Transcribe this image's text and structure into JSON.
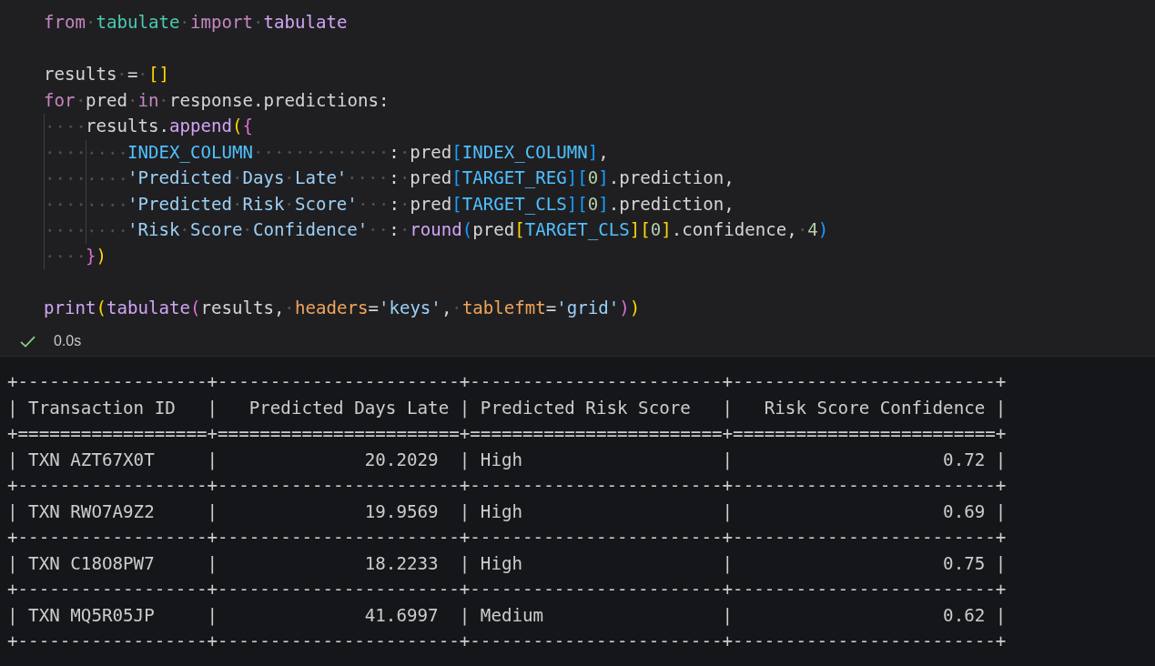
{
  "code": {
    "lines": [
      {
        "kind": "code",
        "tokens": [
          {
            "kind": "keyword",
            "text": "from "
          },
          {
            "kind": "module",
            "text": "tabulate "
          },
          {
            "kind": "keyword",
            "text": "import "
          },
          {
            "kind": "function",
            "text": "tabulate"
          }
        ]
      },
      {
        "kind": "blank"
      },
      {
        "kind": "code",
        "tokens": [
          {
            "kind": "plain",
            "text": "results = "
          },
          {
            "kind": "bracket1",
            "text": "[]"
          }
        ]
      },
      {
        "kind": "code",
        "tokens": [
          {
            "kind": "keyword",
            "text": "for"
          },
          {
            "kind": "plain",
            "text": " pred "
          },
          {
            "kind": "keyword",
            "text": "in"
          },
          {
            "kind": "plain",
            "text": " response.predictions:"
          }
        ],
        "children": [
          {
            "kind": "code",
            "tokens": [
              {
                "kind": "plain",
                "text": "results."
              },
              {
                "kind": "function",
                "text": "append"
              },
              {
                "kind": "bracket1",
                "text": "("
              },
              {
                "kind": "bracket2",
                "text": "{"
              }
            ],
            "children": [
              {
                "kind": "code",
                "tokens": [
                  {
                    "kind": "constant",
                    "text": "INDEX_COLUMN"
                  },
                  {
                    "kind": "plain",
                    "text": "             : pred"
                  },
                  {
                    "kind": "bracket3",
                    "text": "["
                  },
                  {
                    "kind": "constant",
                    "text": "INDEX_COLUMN"
                  },
                  {
                    "kind": "bracket3",
                    "text": "]"
                  },
                  {
                    "kind": "plain",
                    "text": ","
                  }
                ]
              },
              {
                "kind": "code",
                "tokens": [
                  {
                    "kind": "string",
                    "text": "'Predicted Days Late'"
                  },
                  {
                    "kind": "plain",
                    "text": "    : pred"
                  },
                  {
                    "kind": "bracket3",
                    "text": "["
                  },
                  {
                    "kind": "constant",
                    "text": "TARGET_REG"
                  },
                  {
                    "kind": "bracket3",
                    "text": "]["
                  },
                  {
                    "kind": "number",
                    "text": "0"
                  },
                  {
                    "kind": "bracket3",
                    "text": "]"
                  },
                  {
                    "kind": "plain",
                    "text": ".prediction,"
                  }
                ]
              },
              {
                "kind": "code",
                "tokens": [
                  {
                    "kind": "string",
                    "text": "'Predicted Risk Score'"
                  },
                  {
                    "kind": "plain",
                    "text": "   : pred"
                  },
                  {
                    "kind": "bracket3",
                    "text": "["
                  },
                  {
                    "kind": "constant",
                    "text": "TARGET_CLS"
                  },
                  {
                    "kind": "bracket3",
                    "text": "]["
                  },
                  {
                    "kind": "number",
                    "text": "0"
                  },
                  {
                    "kind": "bracket3",
                    "text": "]"
                  },
                  {
                    "kind": "plain",
                    "text": ".prediction,"
                  }
                ]
              },
              {
                "kind": "code",
                "tokens": [
                  {
                    "kind": "string",
                    "text": "'Risk Score Confidence'"
                  },
                  {
                    "kind": "plain",
                    "text": "  : "
                  },
                  {
                    "kind": "function",
                    "text": "round"
                  },
                  {
                    "kind": "bracket3",
                    "text": "("
                  },
                  {
                    "kind": "plain",
                    "text": "pred"
                  },
                  {
                    "kind": "bracket1",
                    "text": "["
                  },
                  {
                    "kind": "constant",
                    "text": "TARGET_CLS"
                  },
                  {
                    "kind": "bracket1",
                    "text": "]["
                  },
                  {
                    "kind": "number",
                    "text": "0"
                  },
                  {
                    "kind": "bracket1",
                    "text": "]"
                  },
                  {
                    "kind": "plain",
                    "text": ".confidence, "
                  },
                  {
                    "kind": "number",
                    "text": "4"
                  },
                  {
                    "kind": "bracket3",
                    "text": ")"
                  }
                ]
              }
            ]
          },
          {
            "kind": "code",
            "tokens": [
              {
                "kind": "bracket2",
                "text": "}"
              },
              {
                "kind": "bracket1",
                "text": ")"
              }
            ]
          }
        ]
      },
      {
        "kind": "blank"
      },
      {
        "kind": "code",
        "tokens": [
          {
            "kind": "function",
            "text": "print"
          },
          {
            "kind": "bracket1",
            "text": "("
          },
          {
            "kind": "function",
            "text": "tabulate"
          },
          {
            "kind": "bracket2",
            "text": "("
          },
          {
            "kind": "plain",
            "text": "results, "
          },
          {
            "kind": "parameter",
            "text": "headers"
          },
          {
            "kind": "plain",
            "text": "="
          },
          {
            "kind": "string",
            "text": "'keys'"
          },
          {
            "kind": "plain",
            "text": ", "
          },
          {
            "kind": "parameter",
            "text": "tablefmt"
          },
          {
            "kind": "plain",
            "text": "="
          },
          {
            "kind": "string",
            "text": "'grid'"
          },
          {
            "kind": "bracket2",
            "text": ")"
          },
          {
            "kind": "bracket1",
            "text": ")"
          }
        ]
      }
    ]
  },
  "status": {
    "succeeded": true,
    "time": "0.0s"
  },
  "output": {
    "lines": [
      "+------------------+-----------------------+------------------------+-------------------------+",
      "| Transaction ID   |   Predicted Days Late | Predicted Risk Score   |   Risk Score Confidence |",
      "+==================+=======================+========================+=========================+",
      "| TXN AZT67X0T     |              20.2029  | High                   |                    0.72 |",
      "+------------------+-----------------------+------------------------+-------------------------+",
      "| TXN RWO7A9Z2     |              19.9569  | High                   |                    0.69 |",
      "+------------------+-----------------------+------------------------+-------------------------+",
      "| TXN C18O8PW7     |              18.2233  | High                   |                    0.75 |",
      "+------------------+-----------------------+------------------------+-------------------------+",
      "| TXN MQ5R05JP     |              41.6997  | Medium                 |                    0.62 |",
      "+------------------+-----------------------+------------------------+-------------------------+"
    ]
  }
}
